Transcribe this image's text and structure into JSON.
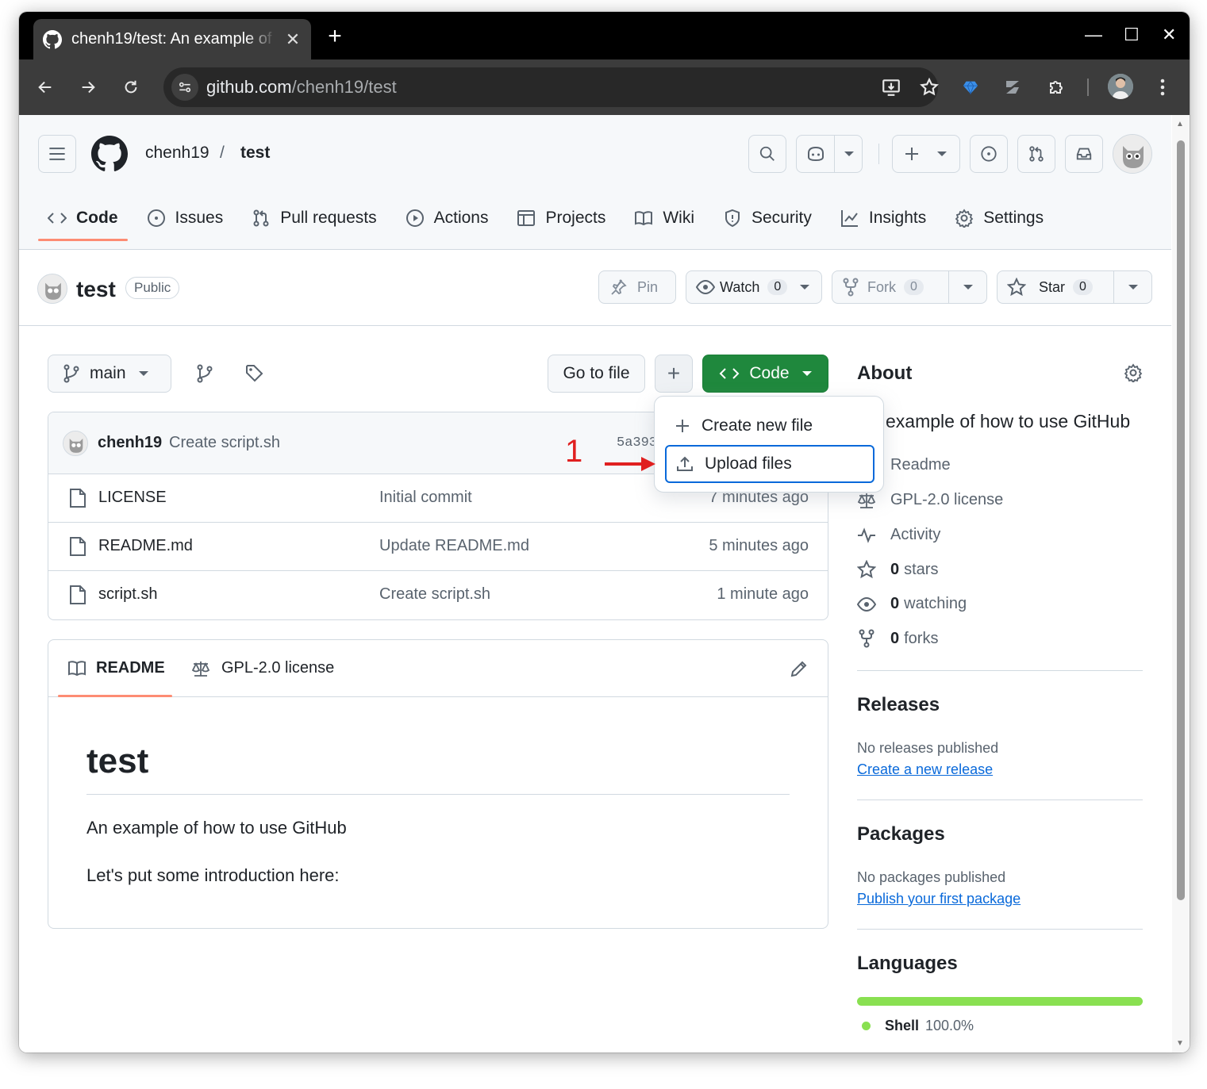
{
  "browser": {
    "tab_title": "chenh19/test: An example of how to use GitHub",
    "url_host": "github.com",
    "url_path": "/chenh19/test"
  },
  "header": {
    "owner": "chenh19",
    "separator": "/",
    "repo": "test"
  },
  "repo_nav": {
    "code": "Code",
    "issues": "Issues",
    "pull_requests": "Pull requests",
    "actions": "Actions",
    "projects": "Projects",
    "wiki": "Wiki",
    "security": "Security",
    "insights": "Insights",
    "settings": "Settings"
  },
  "repo": {
    "name": "test",
    "visibility": "Public",
    "pin": "Pin",
    "watch": "Watch",
    "watch_count": "0",
    "fork": "Fork",
    "fork_count": "0",
    "star": "Star",
    "star_count": "0"
  },
  "toolbar": {
    "branch": "main",
    "go_to_file": "Go to file",
    "add_symbol": "+",
    "code": "Code"
  },
  "add_menu": {
    "create_new_file": "Create new file",
    "upload_files": "Upload files"
  },
  "annotation": {
    "step": "1"
  },
  "commit": {
    "author": "chenh19",
    "message": "Create script.sh",
    "hash": "5a393"
  },
  "files": [
    {
      "name": "LICENSE",
      "message": "Initial commit",
      "time": "7 minutes ago"
    },
    {
      "name": "README.md",
      "message": "Update README.md",
      "time": "5 minutes ago"
    },
    {
      "name": "script.sh",
      "message": "Create script.sh",
      "time": "1 minute ago"
    }
  ],
  "readme": {
    "tab_readme": "README",
    "tab_license": "GPL-2.0 license",
    "heading": "test",
    "paragraph1": "An example of how to use GitHub",
    "paragraph2": "Let's put some introduction here:"
  },
  "about": {
    "title": "About",
    "description": "example of how to use GitHub",
    "readme": "Readme",
    "license": "GPL-2.0 license",
    "activity": "Activity",
    "stars_count": "0",
    "stars_label": "stars",
    "watching_count": "0",
    "watching_label": "watching",
    "forks_count": "0",
    "forks_label": "forks"
  },
  "releases": {
    "title": "Releases",
    "empty": "No releases published",
    "link": "Create a new release"
  },
  "packages": {
    "title": "Packages",
    "empty": "No packages published",
    "link": "Publish your first package"
  },
  "languages": {
    "title": "Languages",
    "name": "Shell",
    "percent": "100.0%",
    "shell_share": 1.0,
    "color": "#89e051"
  }
}
